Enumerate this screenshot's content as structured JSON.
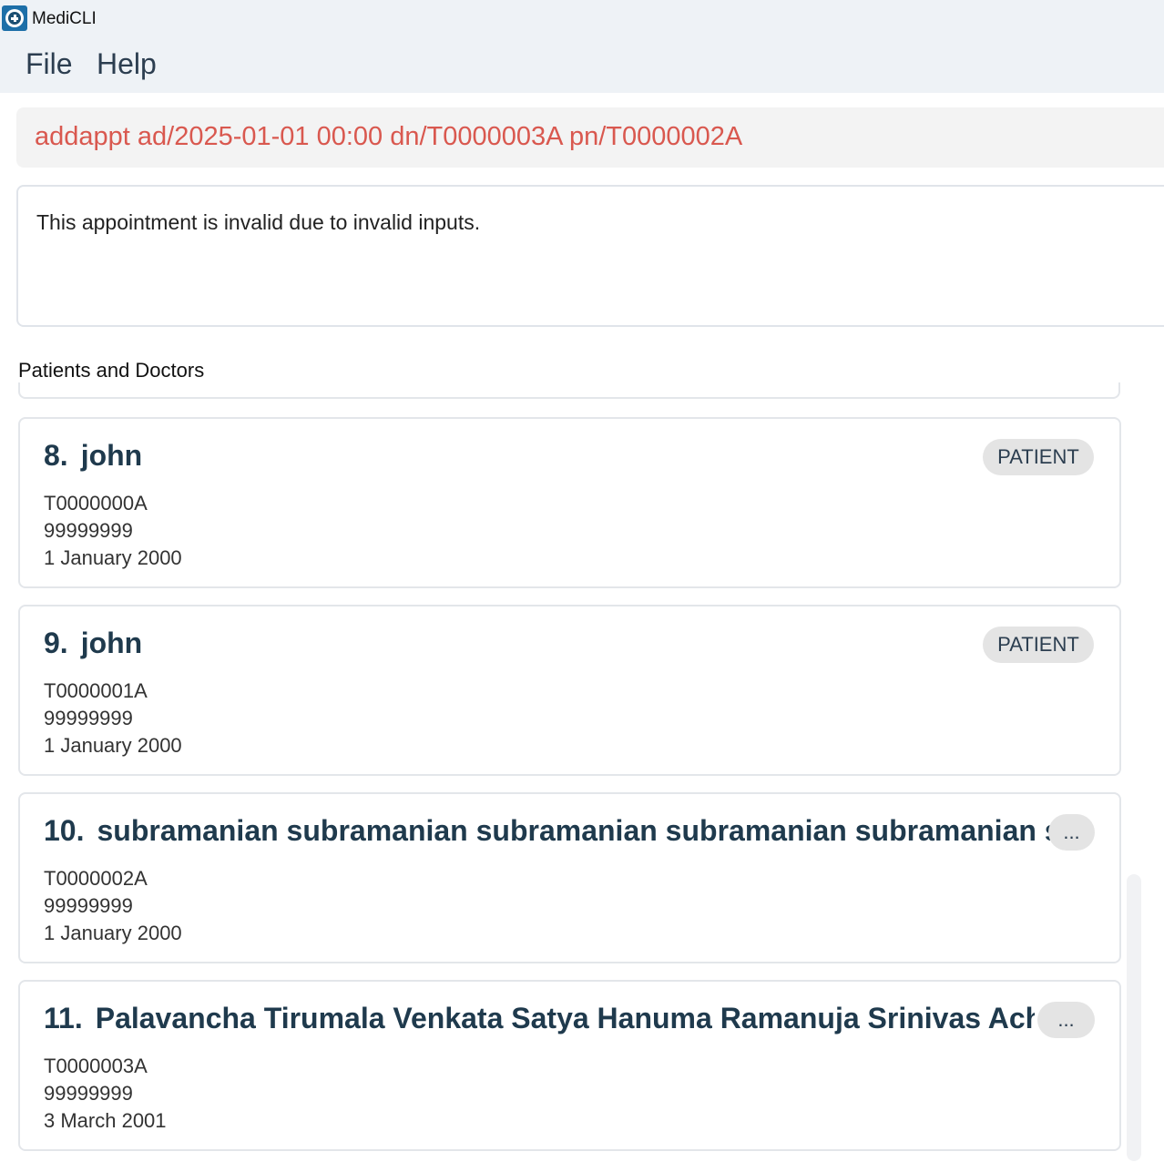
{
  "window": {
    "title": "MediCLI"
  },
  "menu": {
    "file": "File",
    "help": "Help"
  },
  "command": {
    "value": "addappt ad/2025-01-01 00:00 dn/T0000003A pn/T0000002A"
  },
  "result": {
    "message": "This appointment is invalid due to invalid inputs."
  },
  "list": {
    "label": "Patients and Doctors",
    "cards": [
      {
        "index": "8.",
        "name": "john",
        "badge": "PATIENT",
        "nric": "T0000000A",
        "phone": "99999999",
        "dob": "1 January 2000"
      },
      {
        "index": "9.",
        "name": "john",
        "badge": "PATIENT",
        "nric": "T0000001A",
        "phone": "99999999",
        "dob": "1 January 2000"
      },
      {
        "index": "10.",
        "name": "subramanian subramanian subramanian subramanian subramanian su...",
        "badge": "...",
        "nric": "T0000002A",
        "phone": "99999999",
        "dob": "1 January 2000"
      },
      {
        "index": "11.",
        "name": "Palavancha Tirumala Venkata Satya Hanuma Ramanuja Srinivas Ach...",
        "badge": "...",
        "nric": "T0000003A",
        "phone": "99999999",
        "dob": "3 March 2001"
      }
    ]
  },
  "icons": {
    "app": "medical-cross-icon"
  }
}
